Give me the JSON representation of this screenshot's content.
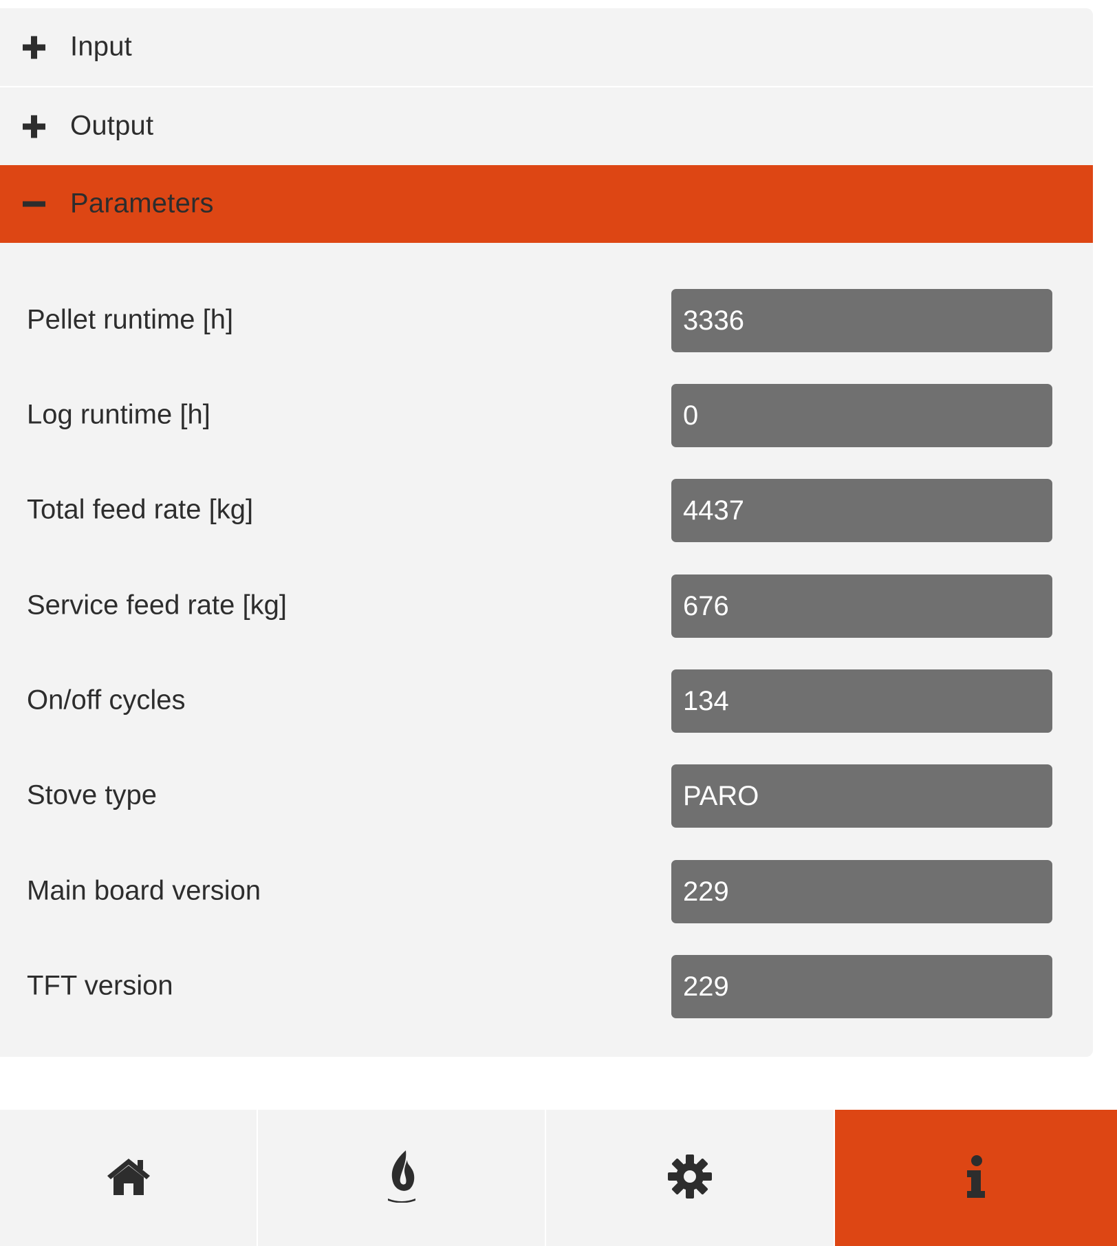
{
  "accordion": {
    "sections": [
      {
        "label": "Input",
        "state": "collapsed",
        "icon": "plus-icon"
      },
      {
        "label": "Output",
        "state": "collapsed",
        "icon": "plus-icon"
      },
      {
        "label": "Parameters",
        "state": "expanded",
        "icon": "minus-icon"
      }
    ]
  },
  "parameters": [
    {
      "label": "Pellet runtime [h]",
      "value": "3336"
    },
    {
      "label": "Log runtime [h]",
      "value": "0"
    },
    {
      "label": "Total feed rate [kg]",
      "value": "4437"
    },
    {
      "label": "Service feed rate [kg]",
      "value": "676"
    },
    {
      "label": "On/off cycles",
      "value": "134"
    },
    {
      "label": "Stove type",
      "value": "PARO"
    },
    {
      "label": "Main board version",
      "value": "229"
    },
    {
      "label": "TFT version",
      "value": "229"
    }
  ],
  "bottom_nav": {
    "items": [
      {
        "icon": "home-icon",
        "active": false
      },
      {
        "icon": "flame-icon",
        "active": false
      },
      {
        "icon": "gear-icon",
        "active": false
      },
      {
        "icon": "info-icon",
        "active": true
      }
    ]
  },
  "colors": {
    "accent": "#dd4614",
    "panel": "#f3f3f3",
    "value_box": "#707070",
    "text": "#2d2d2d",
    "value_text": "#ffffff"
  }
}
